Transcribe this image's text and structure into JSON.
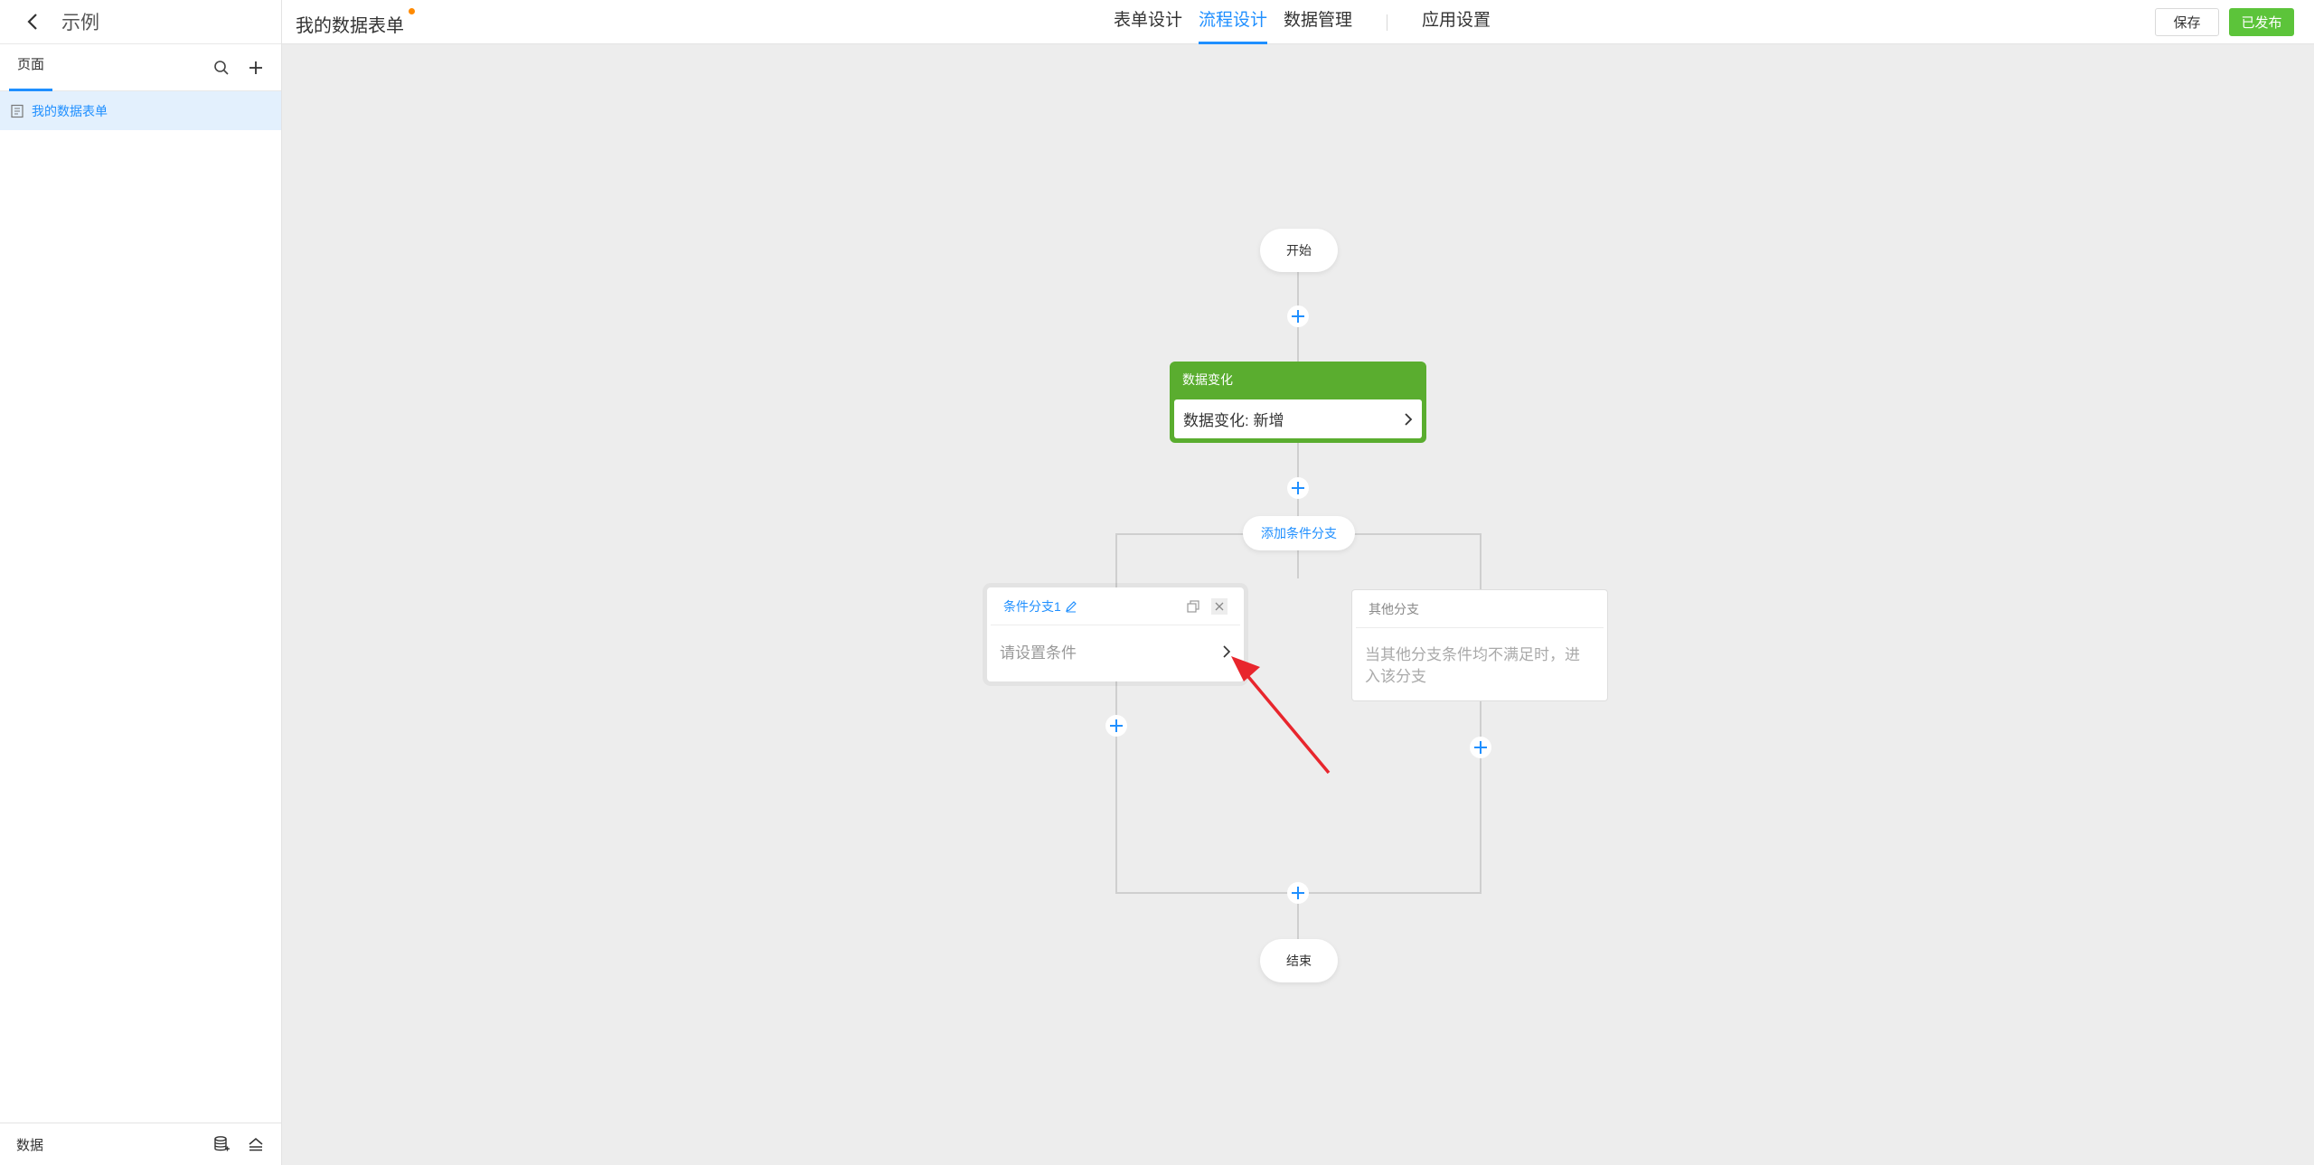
{
  "sidebar": {
    "app_name": "示例",
    "tab_label": "页面",
    "page_item": "我的数据表单",
    "footer_label": "数据"
  },
  "header": {
    "form_title": "我的数据表单",
    "tabs": [
      "表单设计",
      "流程设计",
      "数据管理",
      "应用设置"
    ],
    "active_tab": "流程设计",
    "save_label": "保存",
    "publish_label": "已发布"
  },
  "flow": {
    "start_label": "开始",
    "trigger_title": "数据变化",
    "trigger_body": "数据变化: 新增",
    "add_branch_label": "添加条件分支",
    "branch1_name": "条件分支1",
    "branch1_body": "请设置条件",
    "branch2_name": "其他分支",
    "branch2_body": "当其他分支条件均不满足时，进入该分支",
    "end_label": "结束"
  },
  "colors": {
    "accent": "#1f8fff",
    "trigger_green": "#5aad2f",
    "publish_green": "#5cc43a",
    "arrow_red": "#e8262d"
  }
}
